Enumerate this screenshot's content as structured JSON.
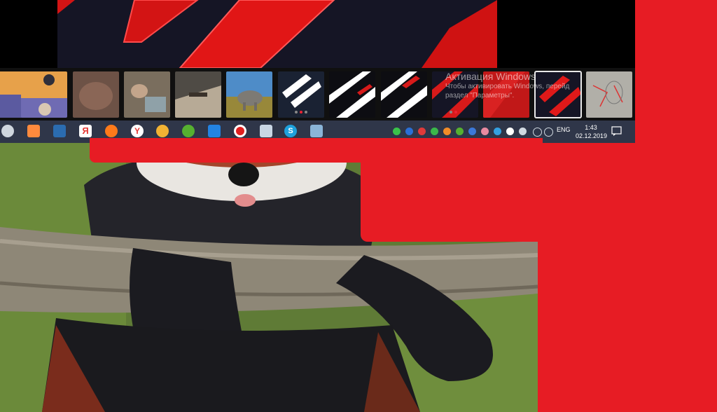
{
  "watermark": {
    "title": "Активация Windows",
    "line1": "Чтобы активировать Windows, перейд",
    "line2": "раздел \"Параметры\"."
  },
  "taskbar": {
    "apps": [
      {
        "id": "alien",
        "icon": "alien-icon",
        "color": "#d0d0d0"
      },
      {
        "id": "calendar",
        "icon": "calendar-icon",
        "color": "#ff8a3d"
      },
      {
        "id": "save",
        "icon": "floppy-disk-icon",
        "color": "#2b6cb0"
      },
      {
        "id": "yandex-browser",
        "icon": "yandex-icon",
        "color": "#e53935"
      },
      {
        "id": "firefox",
        "icon": "firefox-icon",
        "color": "#ff7a1a"
      },
      {
        "id": "yandex",
        "icon": "yandex-y-icon",
        "color": "#ffffff"
      },
      {
        "id": "radio",
        "icon": "headphones-icon",
        "color": "#f2b233"
      },
      {
        "id": "utorrent",
        "icon": "utorrent-icon",
        "color": "#56b030"
      },
      {
        "id": "download",
        "icon": "download-icon",
        "color": "#2383e2"
      },
      {
        "id": "recorder",
        "icon": "record-icon",
        "color": "#e02020"
      },
      {
        "id": "mic",
        "icon": "microphone-icon",
        "color": "#c9d6e4"
      },
      {
        "id": "skype",
        "icon": "skype-icon",
        "color": "#1ea1dc"
      },
      {
        "id": "paint",
        "icon": "palette-icon",
        "color": "#8ab4d8"
      }
    ],
    "language": "ENG",
    "time": "1:43",
    "date": "02.12.2019"
  },
  "colors": {
    "accent_red": "#e71c24",
    "taskbar_bg": "#28374b",
    "thumb_strip": "#101010"
  }
}
